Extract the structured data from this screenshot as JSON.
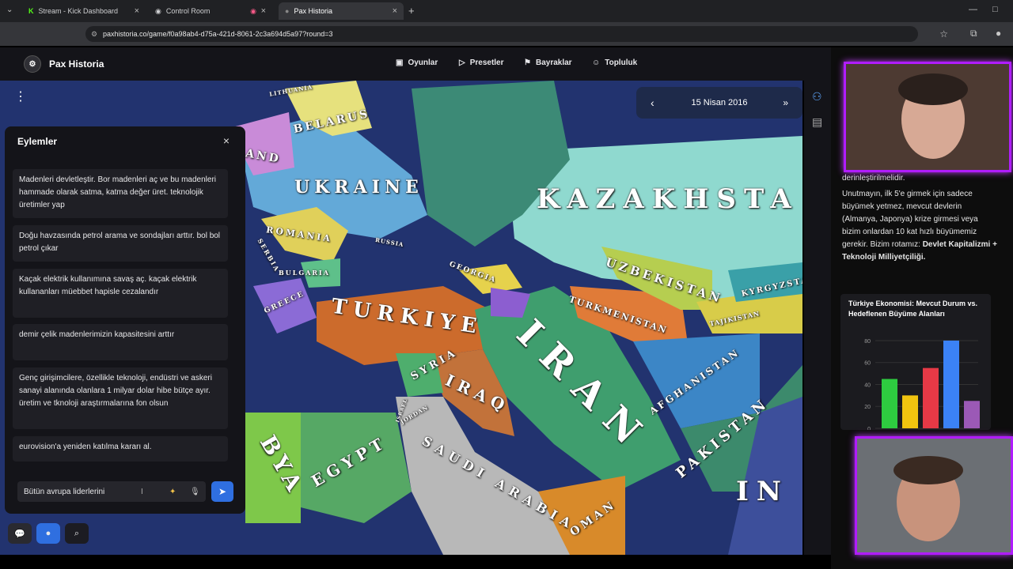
{
  "browser": {
    "tabs": [
      {
        "label": "Stream - Kick Dashboard"
      },
      {
        "label": "Control Room"
      },
      {
        "label": "Pax Historia"
      }
    ],
    "url": "paxhistoria.co/game/f0a98ab4-d75a-421d-8061-2c3a694d5a97?round=3"
  },
  "app": {
    "brand": "Pax Historia",
    "nav": [
      "Oyunlar",
      "Presetler",
      "Bayraklar",
      "Topluluk"
    ]
  },
  "map": {
    "date": "15 Nisan 2016",
    "labels": [
      "BELARUS",
      "UKRAINE",
      "KAZAKHSTA",
      "ROMANIA",
      "TURKIYE",
      "IRAN",
      "IRAQ",
      "SYRIA",
      "EGYPT",
      "SAUDI ARABIA",
      "UZBEKISTAN",
      "TURKMENISTAN",
      "AFGHANISTAN",
      "PAKISTAN",
      "GEORGIA",
      "OMAN",
      "IN",
      "GREECE",
      "BULGARIA",
      "SERBIA",
      "AND",
      "KYRGYZSTA",
      "TAJIKISTAN",
      "JORDAN",
      "LITHUANIA",
      "RUSSIA",
      "ISRAEL",
      "BYA"
    ]
  },
  "panel": {
    "title": "Eylemler",
    "actions": [
      "Madenleri devletleştir. Bor madenleri aç ve bu madenleri hammade olarak satma, katma değer üret. teknolojik üretimler yap",
      "Doğu havzasında petrol arama ve sondajları arttır. bol bol petrol çıkar",
      "Kaçak elektrik kullanımına savaş aç. kaçak elektrik kullananları müebbet hapisle cezalandır",
      "demir çelik madenlerimizin kapasitesini arttır",
      "Genç girişimcilere, özellikle teknoloji, endüstri ve askeri sanayi alanında olanlara 1 milyar dolar hibe bütçe ayır. üretim ve tknoloji araştırmalarına fon olsun",
      "eurovision'a yeniden katılma kararı al."
    ],
    "input_value": "Bütün avrupa liderlerini"
  },
  "article": {
    "line0": "derinleştirilmelidir.",
    "para": "Unutmayın, ilk 5'e girmek için sadece büyümek yetmez, mevcut devlerin (Almanya, Japonya) krize girmesi veya bizim onlardan 10 kat hızlı büyümemiz gerekir. Bizim rotamız:",
    "bold": "Devlet Kapitalizmi + Teknoloji Milliyetçiliği."
  },
  "chart_data": {
    "type": "bar",
    "title": "Türkiye Ekonomisi: Mevcut Durum vs. Hedeflenen Büyüme Alanları",
    "categories": [
      "",
      "",
      "",
      "",
      ""
    ],
    "values": [
      45,
      30,
      55,
      80,
      25
    ],
    "colors": [
      "#2ecc40",
      "#f1c40f",
      "#e63946",
      "#3b82f6",
      "#9b59b6"
    ],
    "yticks": [
      "0",
      "20",
      "40",
      "60",
      "80"
    ],
    "ylim": [
      0,
      85
    ]
  }
}
